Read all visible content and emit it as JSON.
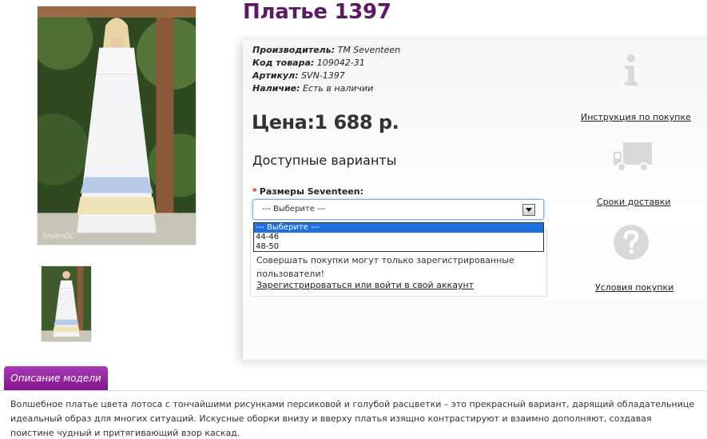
{
  "product": {
    "title": "Платье 1397",
    "manufacturer_label": "Производитель:",
    "manufacturer_value": "TM Seventeen",
    "code_label": "Код товара:",
    "code_value": "109042-31",
    "article_label": "Артикул:",
    "article_value": "SVN-1397",
    "availability_label": "Наличие:",
    "availability_value": "Есть в наличии",
    "price_label": "Цена:",
    "price_value": "1 688 р."
  },
  "options": {
    "heading": "Доступные варианты",
    "required_mark": "*",
    "size_label": "Размеры Seventeen:",
    "selected": "--- Выберите ---",
    "list": [
      "--- Выберите ---",
      "44-46",
      "48-50"
    ]
  },
  "notice": {
    "text": "Совершать покупки могут только зарегистрированные пользователи!",
    "link": "Зарегистрироваться или войти в свой аккаунт"
  },
  "side_links": {
    "instruction": "Инструкция по покупке",
    "delivery": "Сроки доставки",
    "terms": "Условия покупки",
    "icons": [
      "info-icon",
      "truck-icon",
      "question-icon"
    ],
    "icon_color": "#d9d9d9"
  },
  "description": {
    "tab_label": "Описание модели",
    "text": "Волшебное платье цвета лотоса с тончайшими рисунками персиковой и голубой расцветки – это прекрасный вариант, дарящий обладательнице идеальный образ для многих ситуаций. Искусные оборки внизу и вверху платья изящно контрастируют и взаимно дополняют, создавая поистине чудный и притягивающий взор каскад."
  },
  "colors": {
    "title": "#5b1a62",
    "tab": "#9a2aa5",
    "select_highlight": "#1e6fe0"
  },
  "watermark": "SevenDC"
}
